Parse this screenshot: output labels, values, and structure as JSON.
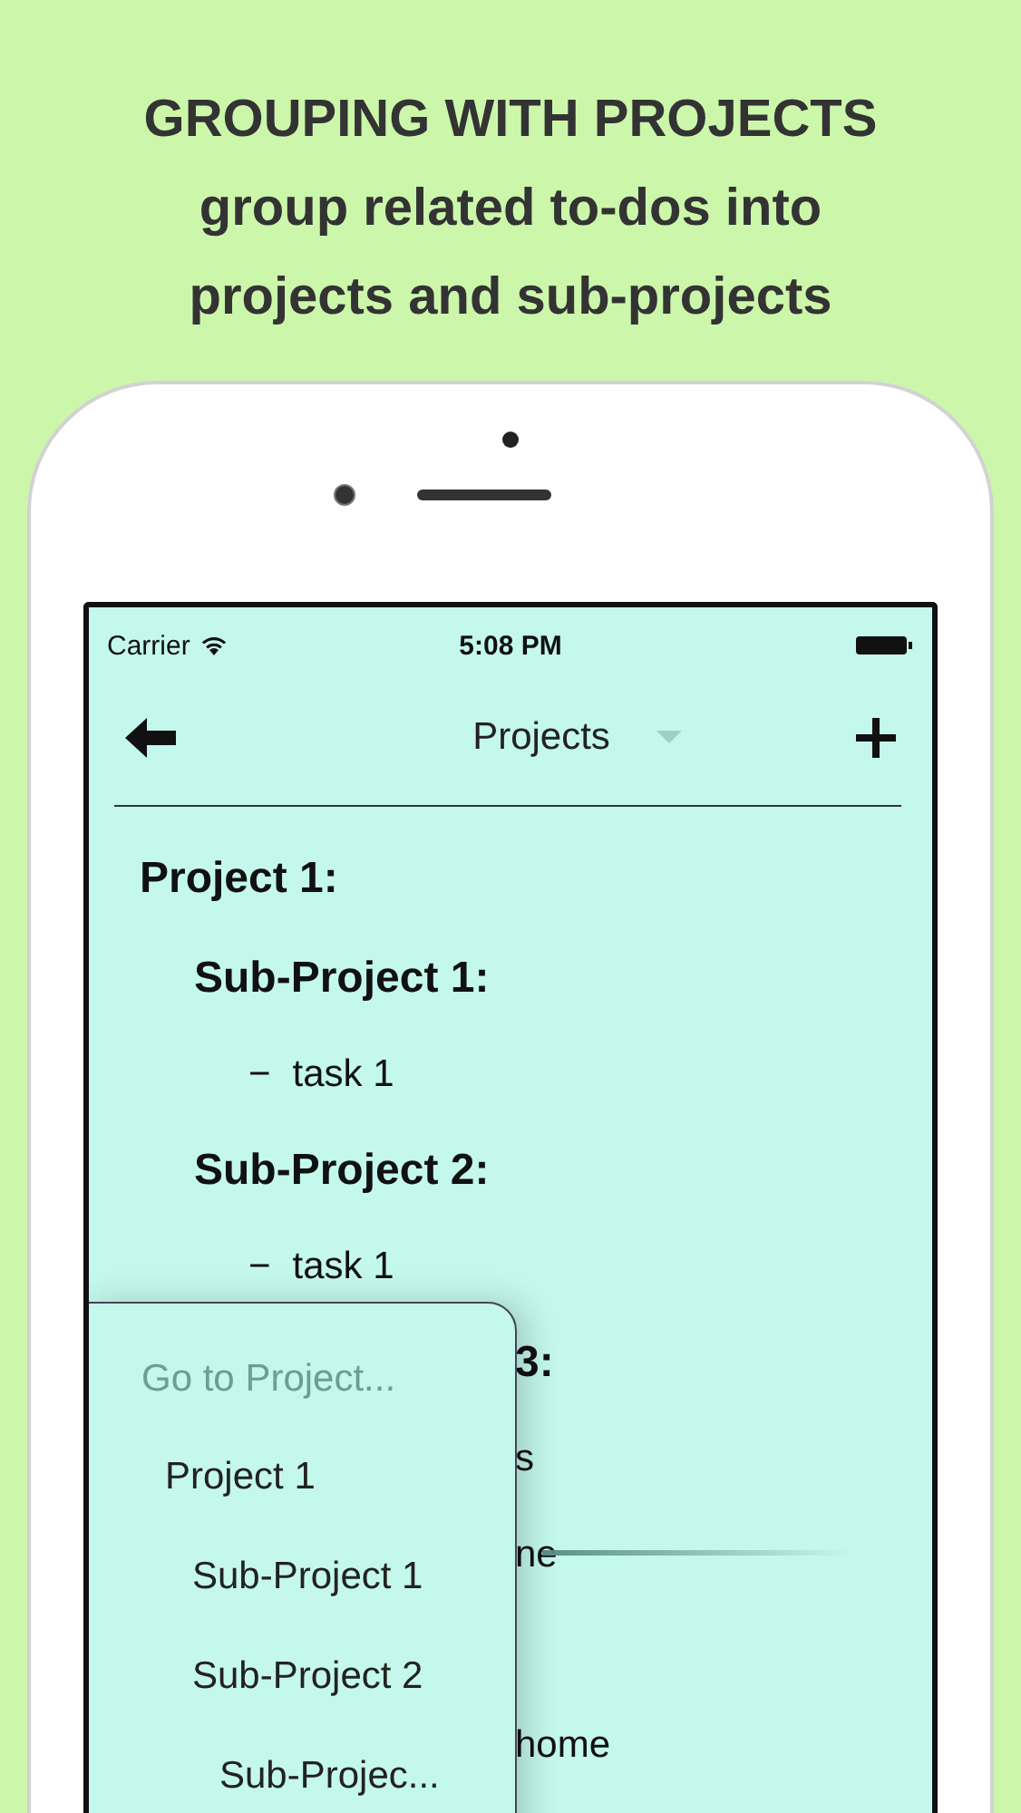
{
  "headline": {
    "title": "GROUPING WITH PROJECTS",
    "subtitle": "group related to-dos into projects and sub-projects"
  },
  "status_bar": {
    "carrier": "Carrier",
    "time": "5:08 PM"
  },
  "nav": {
    "title": "Projects"
  },
  "outline": [
    {
      "kind": "project",
      "label": "Project 1:",
      "children": [
        {
          "kind": "subproject",
          "label": "Sub-Project 1:",
          "children": [
            {
              "kind": "task",
              "bullet": "−",
              "label": "task 1"
            }
          ]
        },
        {
          "kind": "subproject",
          "label": "Sub-Project 2:",
          "children": [
            {
              "kind": "task",
              "bullet": "−",
              "label": "task 1"
            }
          ]
        }
      ]
    }
  ],
  "covered_rows": [
    {
      "kind": "subproject",
      "text": "3:"
    },
    {
      "kind": "task",
      "text": "s"
    },
    {
      "kind": "task",
      "text": "ne"
    },
    {
      "kind": "task",
      "text": "home"
    }
  ],
  "project_menu": {
    "prompt": "Go to Project...",
    "items": [
      {
        "label": "Project 1",
        "children": [
          {
            "label": "Sub-Project 1"
          },
          {
            "label": "Sub-Project 2",
            "children": [
              {
                "label": "Sub-Projec..."
              }
            ]
          }
        ]
      }
    ]
  }
}
